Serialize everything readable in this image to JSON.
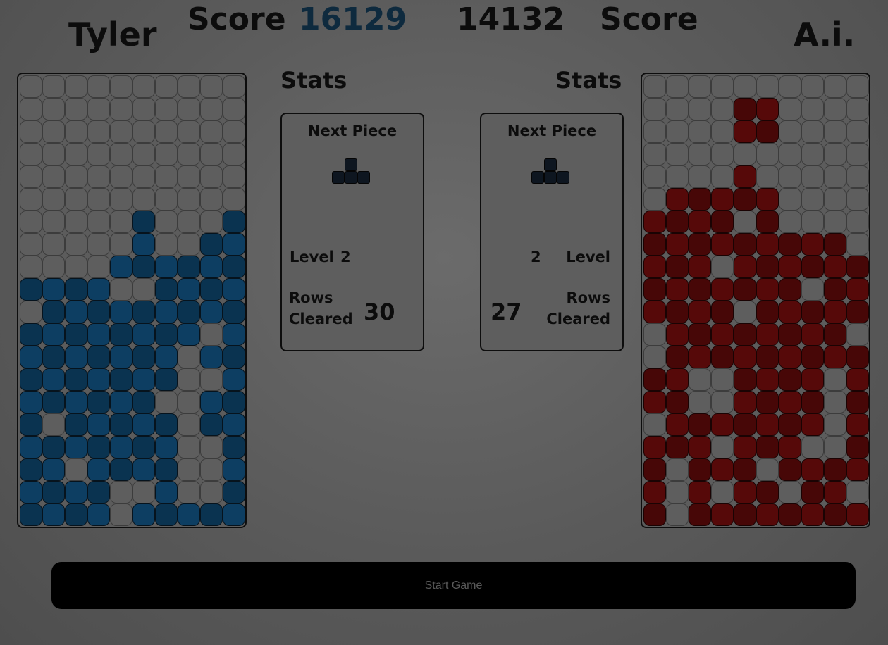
{
  "players": {
    "left": {
      "name": "Tyler",
      "score_label": "Score",
      "score": "16129"
    },
    "right": {
      "name": "A.i.",
      "score_label": "Score",
      "score": "14132"
    }
  },
  "stats": {
    "left": {
      "heading": "Stats",
      "next_piece_label": "Next Piece",
      "level_label": "Level",
      "level": "2",
      "rows_label_1": "Rows",
      "rows_label_2": "Cleared",
      "rows": "30"
    },
    "right": {
      "heading": "Stats",
      "next_piece_label": "Next Piece",
      "level_label": "Level",
      "level": "2",
      "rows_label_1": "Rows",
      "rows_label_2": "Cleared",
      "rows": "27"
    }
  },
  "next_piece": {
    "left": "T",
    "right": "T"
  },
  "colors": {
    "player_block": "#0d3e62",
    "ai_block": "#560909",
    "empty_cell": "#5e5e5e",
    "score_left": "#0e2a3e"
  },
  "boards": {
    "left": [
      "..........",
      "..........",
      "..........",
      "..........",
      "..........",
      "..........",
      ".....#...#",
      ".....#..##",
      "....######",
      "####..####",
      ".#########",
      "########.#",
      "#######.##",
      "#######..#",
      "######..##",
      "#.#####.##",
      "#######..#",
      "##.####..#",
      "####..#..#",
      "####.#####"
    ],
    "right": [
      "..........",
      "....##....",
      "....##....",
      "..........",
      "....#.....",
      ".#####....",
      "####.#....",
      "#########.",
      "###.######",
      "#######.##",
      "####.#####",
      ".########.",
      ".#########",
      "##..####.#",
      "##..####.#",
      ".#######.#",
      "###.###..#",
      "#.###.####",
      "#.#.##.##.",
      "#.########"
    ]
  },
  "start_button": {
    "label": "Start Game"
  }
}
